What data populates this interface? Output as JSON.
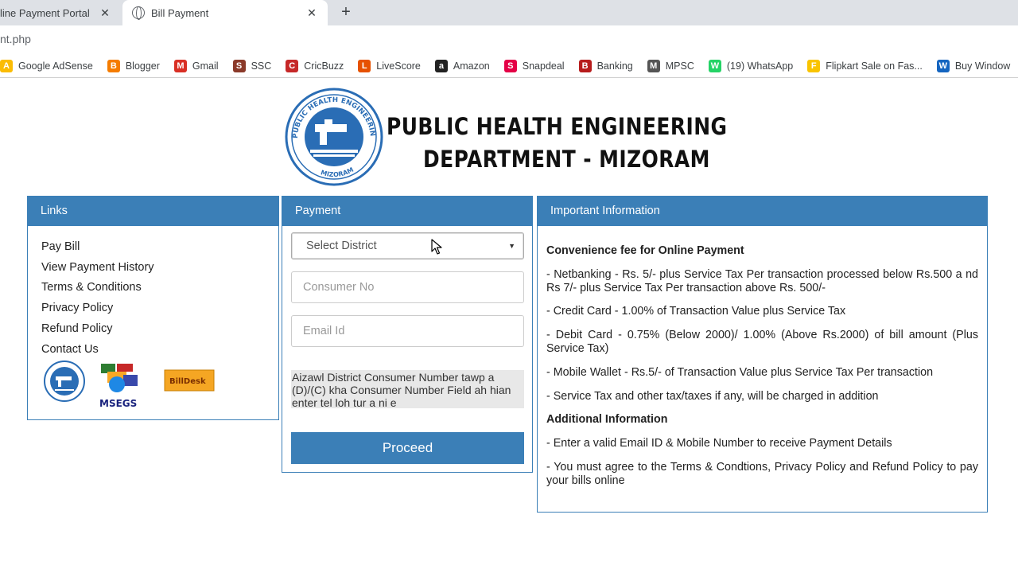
{
  "browser": {
    "tabs": [
      {
        "label": "line Payment Portal",
        "active": false
      },
      {
        "label": "Bill Payment",
        "active": true
      }
    ],
    "url": "nt.php",
    "bookmarks": [
      {
        "label": "Google AdSense",
        "icon": "adsense-icon",
        "color": "#fbbc04"
      },
      {
        "label": "Blogger",
        "icon": "blogger-icon",
        "color": "#f57c00"
      },
      {
        "label": "Gmail",
        "icon": "gmail-icon",
        "color": "#d93025"
      },
      {
        "label": "SSC",
        "icon": "ssc-icon",
        "color": "#8b3a2a"
      },
      {
        "label": "CricBuzz",
        "icon": "cricbuzz-icon",
        "color": "#c62828"
      },
      {
        "label": "LiveScore",
        "icon": "livescore-icon",
        "color": "#e65100"
      },
      {
        "label": "Amazon",
        "icon": "amazon-icon",
        "color": "#222222"
      },
      {
        "label": "Snapdeal",
        "icon": "snapdeal-icon",
        "color": "#e40046"
      },
      {
        "label": "Banking",
        "icon": "banking-icon",
        "color": "#b71c1c"
      },
      {
        "label": "MPSC",
        "icon": "mpsc-icon",
        "color": "#555555"
      },
      {
        "label": "(19) WhatsApp",
        "icon": "whatsapp-icon",
        "color": "#25d366"
      },
      {
        "label": "Flipkart Sale on Fas...",
        "icon": "flipkart-icon",
        "color": "#f9c400"
      },
      {
        "label": "Buy Window",
        "icon": "windows-icon",
        "color": "#1565c0"
      }
    ]
  },
  "header": {
    "line1": "PUBLIC HEALTH ENGINEERING",
    "line2": "DEPARTMENT  - MIZORAM",
    "logo_text_top": "PUBLIC HEALTH ENGINEERING DEPARTMENT",
    "logo_text_bottom": "MIZORAM"
  },
  "links": {
    "title": "Links",
    "items": [
      "Pay Bill",
      "View Payment History",
      "Terms & Conditions",
      "Privacy Policy",
      "Refund Policy",
      "Contact Us"
    ],
    "partners": {
      "msegs": "MSEGS",
      "billdesk": "BillDesk"
    }
  },
  "payment": {
    "title": "Payment",
    "district_selected": "Select District",
    "consumer_placeholder": "Consumer No",
    "email_placeholder": "Email Id",
    "note": "Aizawl District Consumer Number tawp a (D)/(C) kha Consumer Number Field ah hian enter tel loh tur a ni e",
    "proceed_label": "Proceed"
  },
  "info": {
    "title": "Important Information",
    "heading1": "Convenience fee for Online Payment",
    "fees": [
      "- Netbanking - Rs. 5/- plus Service Tax Per transaction processed below Rs.500 a nd Rs 7/- plus Service Tax Per transaction above Rs. 500/-",
      "- Credit Card - 1.00% of Transaction Value plus Service Tax",
      "- Debit Card - 0.75% (Below 2000)/ 1.00% (Above Rs.2000) of bill amount (Plus Service Tax)",
      "- Mobile Wallet - Rs.5/- of Transaction Value plus Service Tax Per transaction",
      "- Service Tax and other tax/taxes if any, will be charged in addition"
    ],
    "heading2": "Additional Information",
    "additional": [
      "- Enter a valid Email ID & Mobile Number to receive Payment Details",
      "- You must agree to the Terms & Condtions, Privacy Policy and Refund Policy to pay your bills online"
    ]
  },
  "colors": {
    "accent": "#3b7fb7"
  }
}
